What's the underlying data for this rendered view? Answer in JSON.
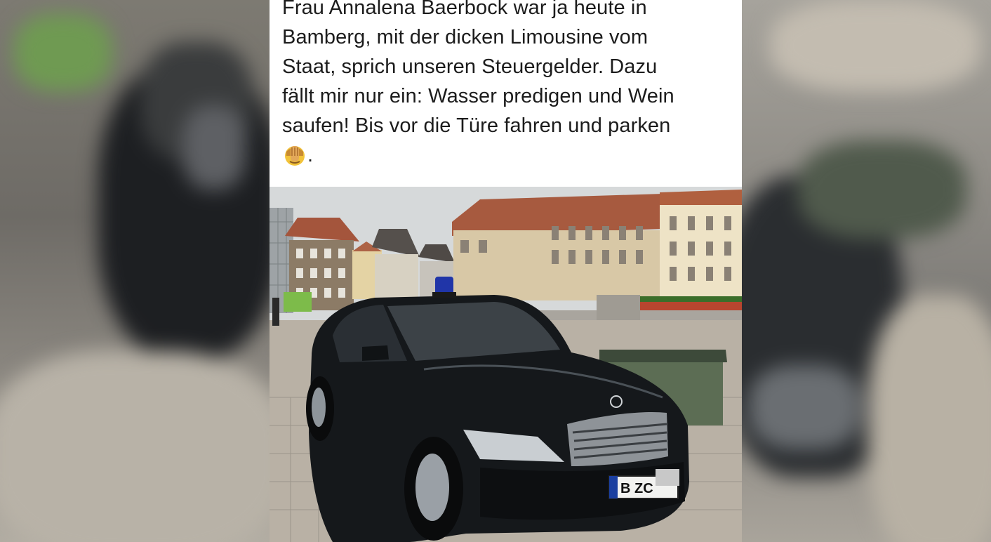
{
  "post": {
    "text_lines": [
      "Frau Annalena Baerbock war ja heute in",
      "Bamberg, mit der dicken Limousine vom",
      "Staat, sprich unseren Steuergelder. Dazu",
      "fällt mir nur ein: Wasser predigen und Wein",
      "saufen! Bis vor die Türe fahren und parken"
    ],
    "trailing_text": ".",
    "emoji_icon": "face-palm-emoji-icon"
  },
  "photo": {
    "license_plate": "B ZC",
    "colors": {
      "car": "#111417",
      "flag": "#4a9a2c",
      "sky": "#d9dcdc",
      "building_left": "#a66a4d",
      "building_right": "#e9dcc0",
      "pavement": "#b7b0a5"
    }
  }
}
